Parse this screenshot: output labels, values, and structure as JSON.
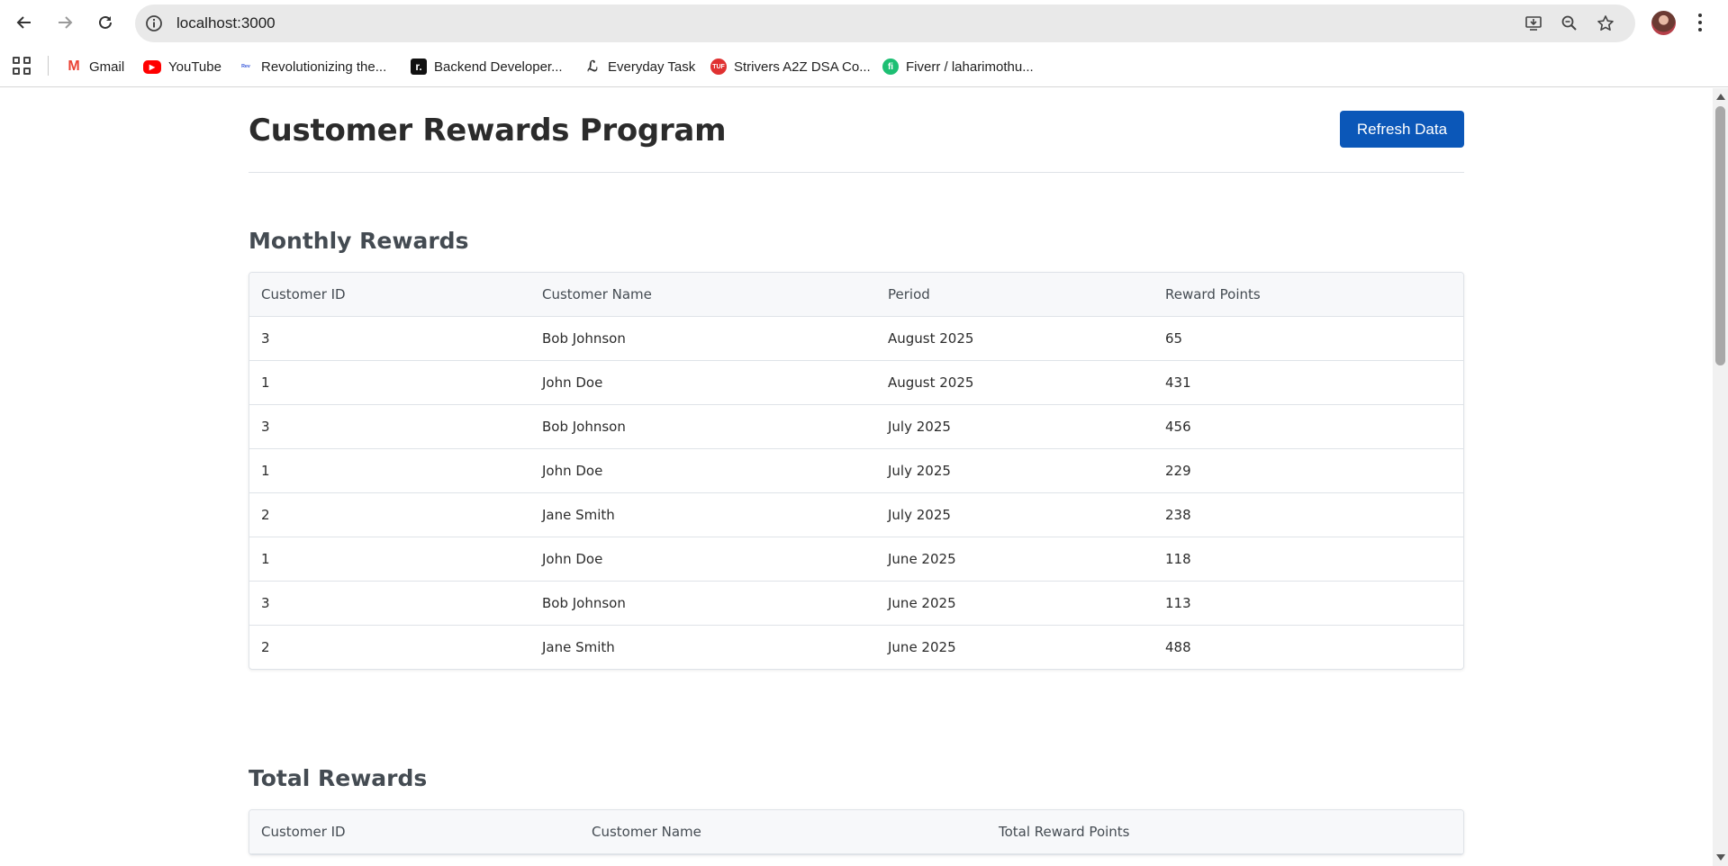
{
  "browser": {
    "url": "localhost:3000",
    "bookmarks": [
      {
        "label": "Gmail",
        "icon": "gmail-icon",
        "color": "#ea4335"
      },
      {
        "label": "YouTube",
        "icon": "youtube-icon",
        "color": "#ff0000"
      },
      {
        "label": "Revolutionizing the...",
        "icon": "site-icon",
        "color": "#3b5bdb"
      },
      {
        "label": "Backend Developer...",
        "icon": "roadmap-icon",
        "color": "#111111"
      },
      {
        "label": "Everyday Task",
        "icon": "leetcode-icon",
        "color": "#f0a020"
      },
      {
        "label": "Strivers A2Z DSA Co...",
        "icon": "tuf-icon",
        "color": "#e03131"
      },
      {
        "label": "Fiverr / laharimothu...",
        "icon": "fiverr-icon",
        "color": "#1dbf73"
      }
    ]
  },
  "header": {
    "title": "Customer Rewards Program",
    "refresh_label": "Refresh Data",
    "refresh_color": "#0b57b8"
  },
  "monthly": {
    "title": "Monthly Rewards",
    "columns": [
      "Customer ID",
      "Customer Name",
      "Period",
      "Reward Points"
    ],
    "rows": [
      [
        "3",
        "Bob Johnson",
        "August 2025",
        "65"
      ],
      [
        "1",
        "John Doe",
        "August 2025",
        "431"
      ],
      [
        "3",
        "Bob Johnson",
        "July 2025",
        "456"
      ],
      [
        "1",
        "John Doe",
        "July 2025",
        "229"
      ],
      [
        "2",
        "Jane Smith",
        "July 2025",
        "238"
      ],
      [
        "1",
        "John Doe",
        "June 2025",
        "118"
      ],
      [
        "3",
        "Bob Johnson",
        "June 2025",
        "113"
      ],
      [
        "2",
        "Jane Smith",
        "June 2025",
        "488"
      ]
    ]
  },
  "totals": {
    "title": "Total Rewards",
    "columns": [
      "Customer ID",
      "Customer Name",
      "Total Reward Points"
    ]
  }
}
